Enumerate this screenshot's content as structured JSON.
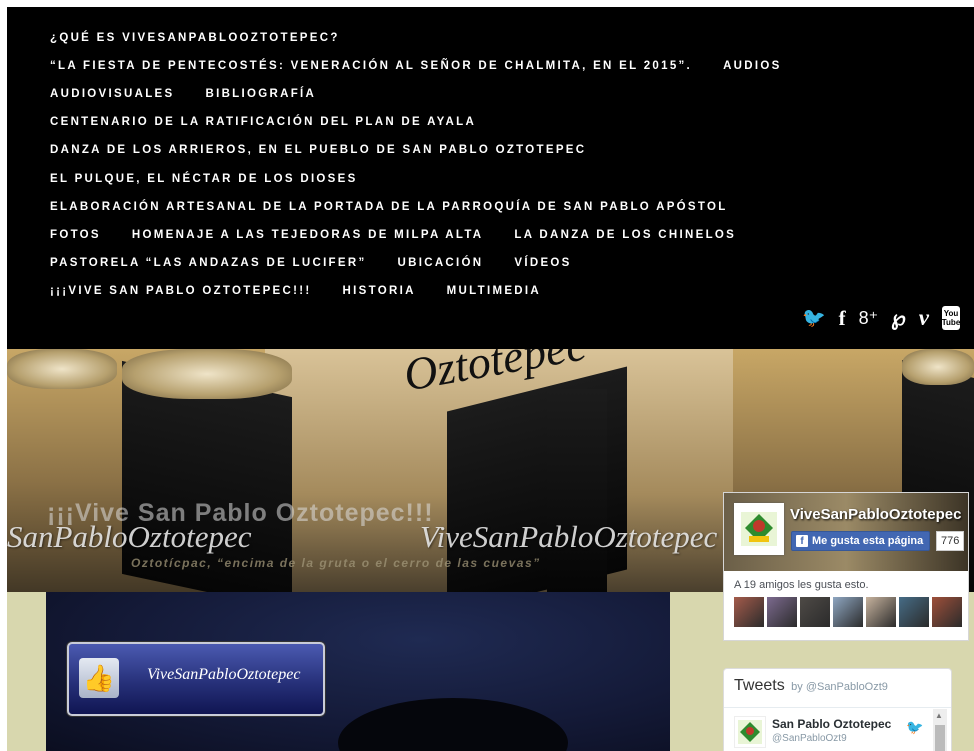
{
  "nav": {
    "rows": [
      [
        "¿QUÉ ES VIVESANPABLOOZTOTEPEC?"
      ],
      [
        "“LA FIESTA DE PENTECOSTÉS: VENERACIÓN AL SEÑOR DE CHALMITA, EN EL 2015”.",
        "AUDIOS"
      ],
      [
        "AUDIOVISUALES",
        "BIBLIOGRAFÍA"
      ],
      [
        "CENTENARIO DE LA RATIFICACIÓN DEL PLAN DE AYALA"
      ],
      [
        "DANZA DE LOS ARRIEROS, EN EL PUEBLO DE SAN PABLO OZTOTEPEC"
      ],
      [
        "EL PULQUE, EL NÉCTAR DE LOS DIOSES"
      ],
      [
        "ELABORACIÓN ARTESANAL DE LA PORTADA DE LA PARROQUÍA DE SAN PABLO APÓSTOL"
      ],
      [
        "FOTOS",
        "HOMENAJE A LAS TEJEDORAS DE MILPA ALTA",
        "LA DANZA DE LOS CHINELOS"
      ],
      [
        "PASTORELA “LAS ANDAZAS DE LUCIFER”",
        "UBICACIÓN",
        "VÍDEOS"
      ],
      [
        "¡¡¡VIVE SAN PABLO OZTOTEPEC!!!",
        "HISTORIA",
        "MULTIMEDIA"
      ]
    ]
  },
  "social": {
    "twitter": "🐦",
    "facebook": "f",
    "googleplus": "8⁺",
    "pinterest": "℘",
    "vimeo": "v",
    "youtube": "You Tube",
    "icons": [
      "twitter-icon",
      "facebook-icon",
      "google-plus-icon",
      "pinterest-icon",
      "vimeo-icon",
      "youtube-icon"
    ]
  },
  "banner": {
    "script_text": "Oztotepec",
    "site_title": "¡¡¡Vive San Pablo Oztotepec!!!",
    "tagline": "Oztotícpac, “encima de la gruta o el cerro de las cuevas”",
    "watermark_left": "SanPabloOztotepec",
    "watermark_right": "ViveSanPabloOztotepec"
  },
  "content": {
    "like_button_text": "ViveSanPabloOztotepec"
  },
  "fb_widget": {
    "page_name": "ViveSanPabloOztotepec",
    "like_label": "Me gusta esta página",
    "like_count": "776",
    "friends_text": "A 19 amigos les gusta esto.",
    "friend_colors": [
      "#a45b4b",
      "#7c6a8f",
      "#4e4a46",
      "#8fa7c2",
      "#c7b39e",
      "#466c86",
      "#9e4f3a"
    ]
  },
  "tw_widget": {
    "title": "Tweets",
    "by": "by @SanPabloOzt9",
    "author": "San Pablo Oztotepec",
    "handle": "@SanPabloOzt9"
  }
}
